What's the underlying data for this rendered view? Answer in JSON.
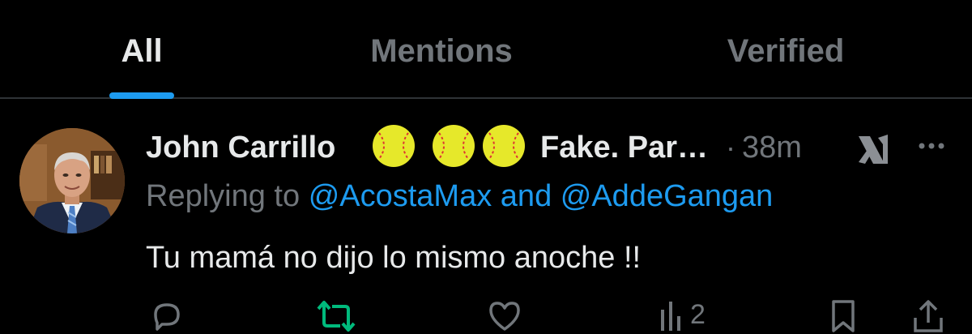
{
  "tabs": [
    {
      "label": "All",
      "active": true
    },
    {
      "label": "Mentions",
      "active": false
    },
    {
      "label": "Verified",
      "active": false
    }
  ],
  "colors": {
    "accent": "#1d9bf0",
    "muted": "#71767b",
    "text": "#e7e9ea",
    "retweet_active": "#00ba7c",
    "background": "#000000"
  },
  "tweet": {
    "author_name": "John Carrillo",
    "name_emojis": [
      "softball-emoji",
      "softball-emoji",
      "softball-emoji"
    ],
    "name_suffix": "Fake. Par…",
    "separator": "·",
    "timestamp": "38m",
    "replying_prefix": "Replying to",
    "reply_mention_1": "@AcostaMax",
    "reply_conjunction": "and",
    "reply_mention_2": "@AddeGangan",
    "text": "Tu mamá no dijo lo mismo anoche !!",
    "views_count": "2",
    "retweeted": true
  },
  "icons": {
    "grok": "grok-icon",
    "more": "more-dots-icon",
    "reply": "reply-icon",
    "retweet": "retweet-icon",
    "like": "heart-icon",
    "views": "views-icon",
    "bookmark": "bookmark-icon",
    "share": "share-icon"
  }
}
